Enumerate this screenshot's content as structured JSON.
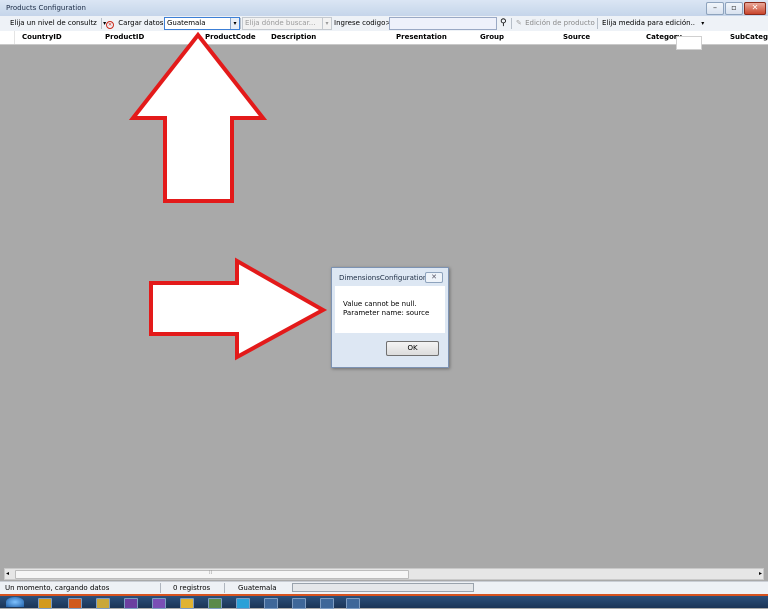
{
  "window": {
    "title": "Products Configuration"
  },
  "toolbar": {
    "level_combo": "Elija un nivel de consultz",
    "load_label": "Cargar datos",
    "country_value": "Guatemala",
    "search_where_placeholder": "Elija dónde buscar...",
    "code_label": "Ingrese codigo>",
    "code_value": "",
    "edit_label": "Edición de producto",
    "measure_label": "Elija medida para edición..",
    "colors": {
      "load_icon": "#cc2a1a",
      "selected_border": "#3c7fd6"
    }
  },
  "grid": {
    "columns": [
      "CountryID",
      "ProductID",
      "ProductCode",
      "Description",
      "Presentation",
      "Group",
      "Source",
      "Category",
      "SubCatego"
    ]
  },
  "dialog": {
    "title": "DimensionsConfiguration",
    "message_line1": "Value cannot be null.",
    "message_line2": "Parameter name: source",
    "ok_label": "OK"
  },
  "statusbar": {
    "message": "Un momento, cargando datos",
    "records": "0 registros",
    "country": "Guatemala",
    "progress": 0
  },
  "annotations": {
    "arrow_color": "#e31a1a"
  }
}
